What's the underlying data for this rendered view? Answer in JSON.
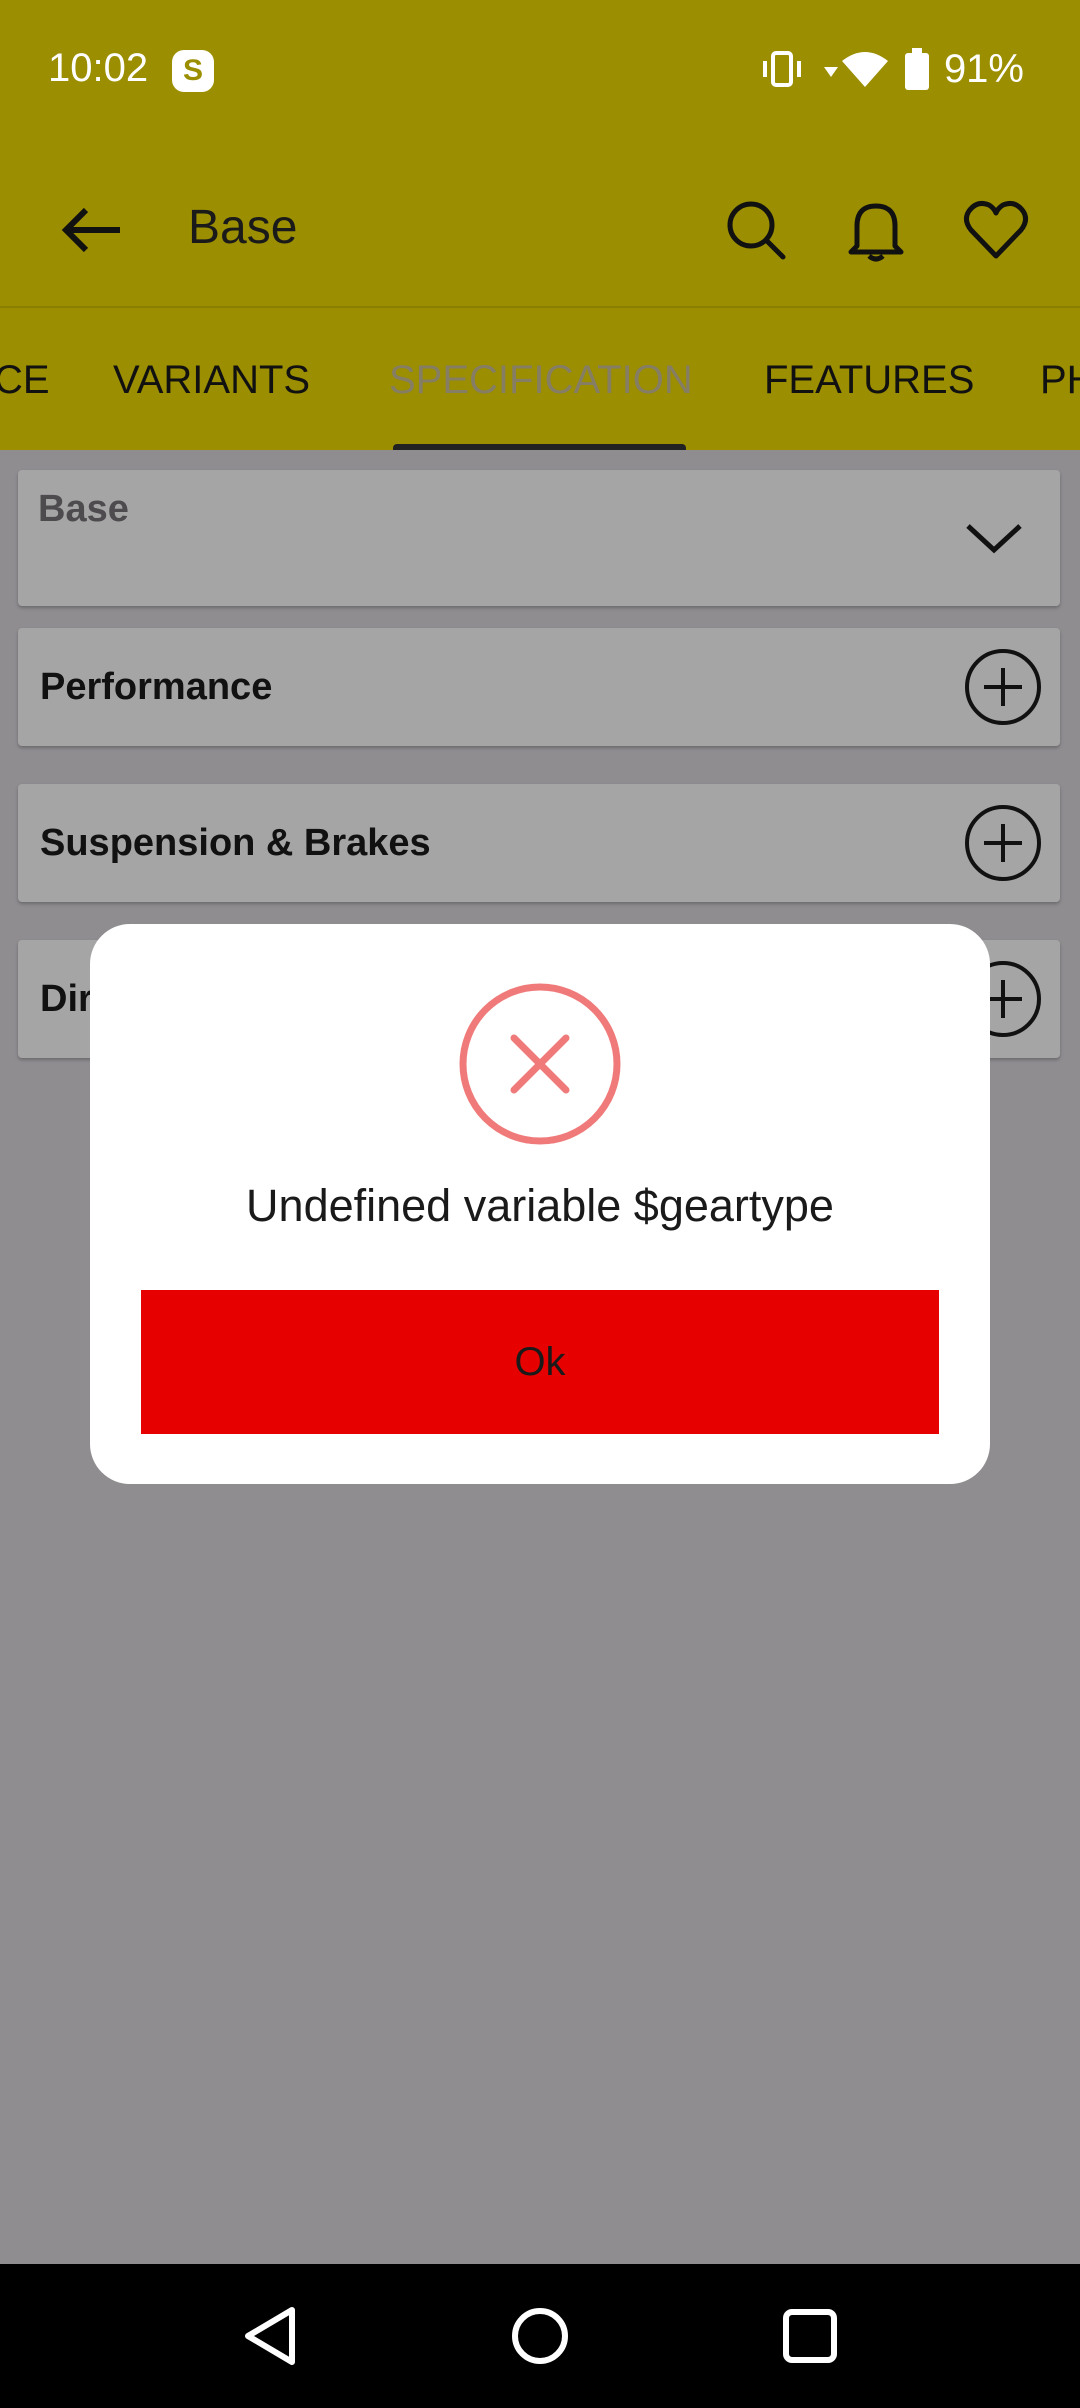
{
  "status_bar": {
    "time": "10:02",
    "battery": "91%",
    "app_badge_letter": "S"
  },
  "app_bar": {
    "title": "Base"
  },
  "tabs": [
    {
      "label": "CE"
    },
    {
      "label": "VARIANTS"
    },
    {
      "label": "SPECIFICATION"
    },
    {
      "label": "FEATURES"
    },
    {
      "label": "PH"
    }
  ],
  "sections": {
    "base_select": "Base",
    "rows": [
      {
        "label": "Performance"
      },
      {
        "label": "Suspension & Brakes"
      },
      {
        "label": "Dir"
      }
    ]
  },
  "dialog": {
    "message": "Undefined variable $geartype",
    "ok_label": "Ok"
  },
  "colors": {
    "app_bar": "#9b8e00",
    "scrim": "#8f8d90",
    "ok_button": "#e60000",
    "error_icon": "#f07a7a"
  }
}
